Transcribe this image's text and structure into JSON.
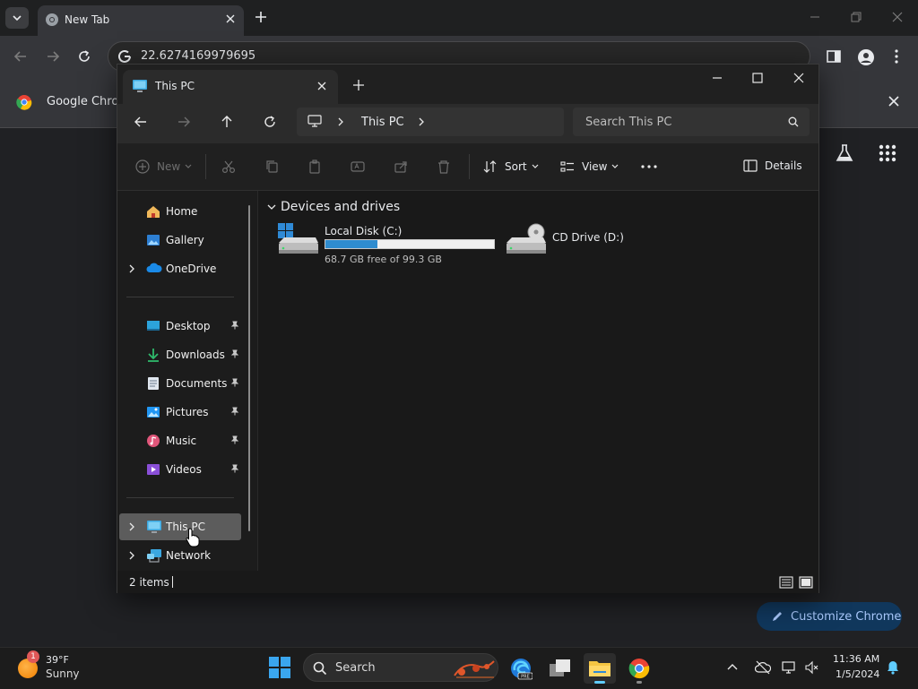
{
  "chrome": {
    "tab_title": "New Tab",
    "url": "22.6274169979695",
    "bookmark_bar_text": "Google Chrom",
    "customize_label": "Customize Chrome"
  },
  "explorer": {
    "tab_title": "This PC",
    "breadcrumb": [
      "This PC"
    ],
    "search_placeholder": "Search This PC",
    "commands": {
      "new": "New",
      "sort": "Sort",
      "view": "View",
      "details": "Details"
    },
    "nav": {
      "home": "Home",
      "gallery": "Gallery",
      "onedrive": "OneDrive",
      "desktop": "Desktop",
      "downloads": "Downloads",
      "documents": "Documents",
      "pictures": "Pictures",
      "music": "Music",
      "videos": "Videos",
      "this_pc": "This PC",
      "network": "Network"
    },
    "group_header": "Devices and drives",
    "drives": [
      {
        "name": "Local Disk (C:)",
        "free_text": "68.7 GB free of 99.3 GB",
        "used_fraction": 0.308
      },
      {
        "name": "CD Drive (D:)"
      }
    ],
    "status_count": "2 items"
  },
  "taskbar": {
    "weather_temp": "39°F",
    "weather_cond": "Sunny",
    "weather_badge": "1",
    "search_label": "Search",
    "time": "11:36 AM",
    "date": "1/5/2024"
  },
  "colors": {
    "accent": "#60cdff",
    "drive_bar_fill": "#2f8ccf",
    "selected_nav": "#5c5c5c"
  }
}
